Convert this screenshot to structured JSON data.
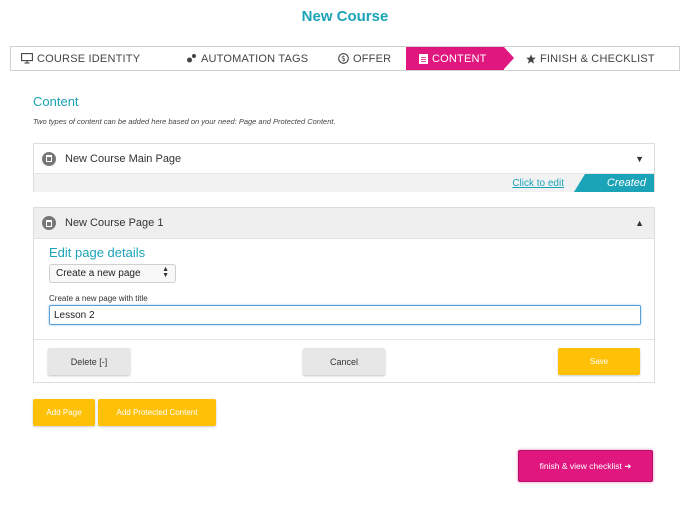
{
  "page": {
    "title": "New Course"
  },
  "steps": [
    {
      "label": "COURSE IDENTITY",
      "icon": "monitor-icon"
    },
    {
      "label": "AUTOMATION TAGS",
      "icon": "tags-icon"
    },
    {
      "label": "OFFER",
      "icon": "dollar-circle-icon"
    },
    {
      "label": "CONTENT",
      "icon": "document-icon",
      "active": true
    },
    {
      "label": "FINISH & CHECKLIST",
      "icon": "star-icon"
    }
  ],
  "content": {
    "title": "Content",
    "description": "Two types of content can be added here based on your need: Page and Protected Content."
  },
  "pages": [
    {
      "title": "New Course Main Page",
      "caret": "▼",
      "edit_link": "Click to edit",
      "status": "Created"
    },
    {
      "title": "New Course Page 1",
      "caret": "▲",
      "edit_heading": "Edit page details",
      "select_value": "Create a new page",
      "field_label": "Create a new page with title",
      "field_value": "Lesson 2",
      "delete_label": "Delete [-]",
      "cancel_label": "Cancel",
      "save_label": "Save"
    }
  ],
  "actions": {
    "add_page": "Add Page",
    "add_protected": "Add Protected Content",
    "finish": "finish & view checklist ➜"
  },
  "colors": {
    "accent": "#1ba3b8",
    "brand": "#e0177f",
    "button_yellow": "#ffc107"
  }
}
